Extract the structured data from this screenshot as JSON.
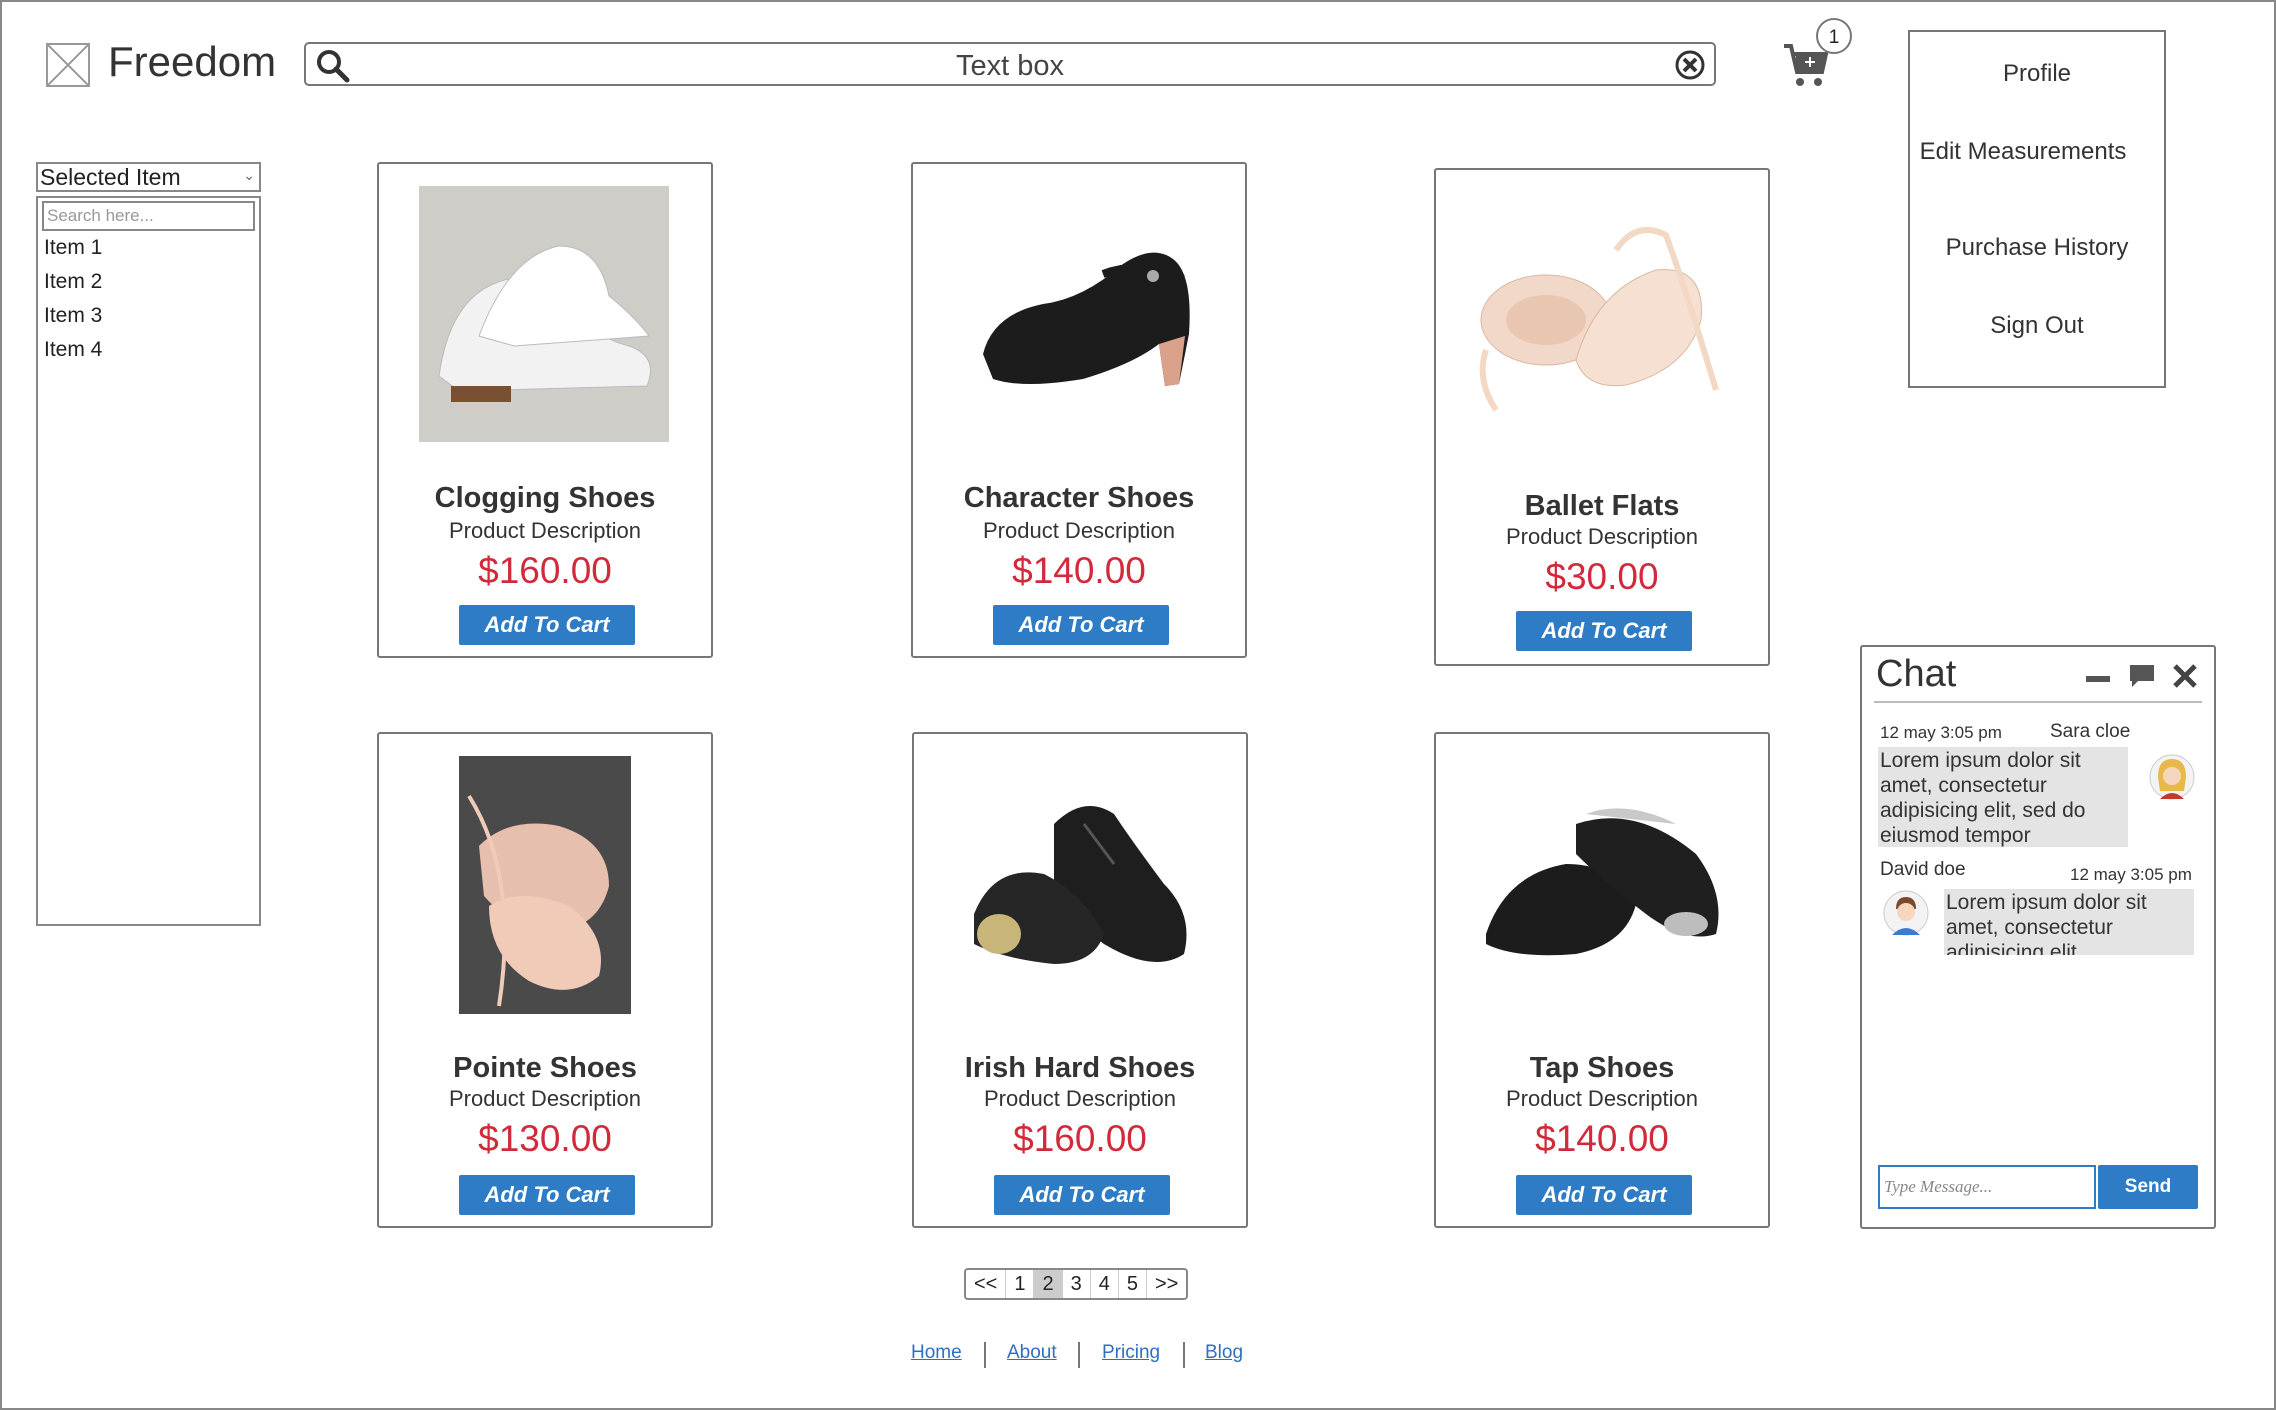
{
  "header": {
    "brand": "Freedom",
    "search_text": "Text box",
    "cart_count": "1"
  },
  "account_menu": {
    "items": [
      "Profile",
      "Edit Measurements",
      "Purchase History",
      "Sign Out"
    ]
  },
  "filter": {
    "selected": "Selected Item",
    "search_placeholder": "Search here...",
    "items": [
      "Item 1",
      "Item 2",
      "Item 3",
      "Item 4"
    ]
  },
  "products": [
    {
      "name": "Clogging Shoes",
      "description": "Product Description",
      "price": "$160.00",
      "button": "Add To Cart"
    },
    {
      "name": "Character Shoes",
      "description": "Product Description",
      "price": "$140.00",
      "button": "Add To Cart"
    },
    {
      "name": "Ballet Flats",
      "description": "Product Description",
      "price": "$30.00",
      "button": "Add To Cart"
    },
    {
      "name": "Pointe Shoes",
      "description": "Product Description",
      "price": "$130.00",
      "button": "Add To Cart"
    },
    {
      "name": "Irish Hard Shoes",
      "description": "Product Description",
      "price": "$160.00",
      "button": "Add To Cart"
    },
    {
      "name": "Tap Shoes",
      "description": "Product Description",
      "price": "$140.00",
      "button": "Add To Cart"
    }
  ],
  "pagination": {
    "prev": "<<",
    "pages": [
      "1",
      "2",
      "3",
      "4",
      "5"
    ],
    "active_page": "2",
    "next": ">>"
  },
  "footer": {
    "links": [
      "Home",
      "About",
      "Pricing",
      "Blog"
    ]
  },
  "chat": {
    "title": "Chat",
    "messages": [
      {
        "time": "12 may 3:05 pm",
        "sender": "Sara cloe",
        "text": "Lorem ipsum dolor sit amet, consectetur adipisicing elit, sed do eiusmod tempor"
      },
      {
        "time": "12 may 3:05 pm",
        "sender": "David doe",
        "text": "Lorem ipsum dolor sit amet, consectetur adipisicing elit"
      }
    ],
    "input_placeholder": "Type Message...",
    "send_label": "Send"
  },
  "colors": {
    "price": "#d12a3a",
    "button": "#2e7cc6",
    "link": "#2e6fc2"
  }
}
